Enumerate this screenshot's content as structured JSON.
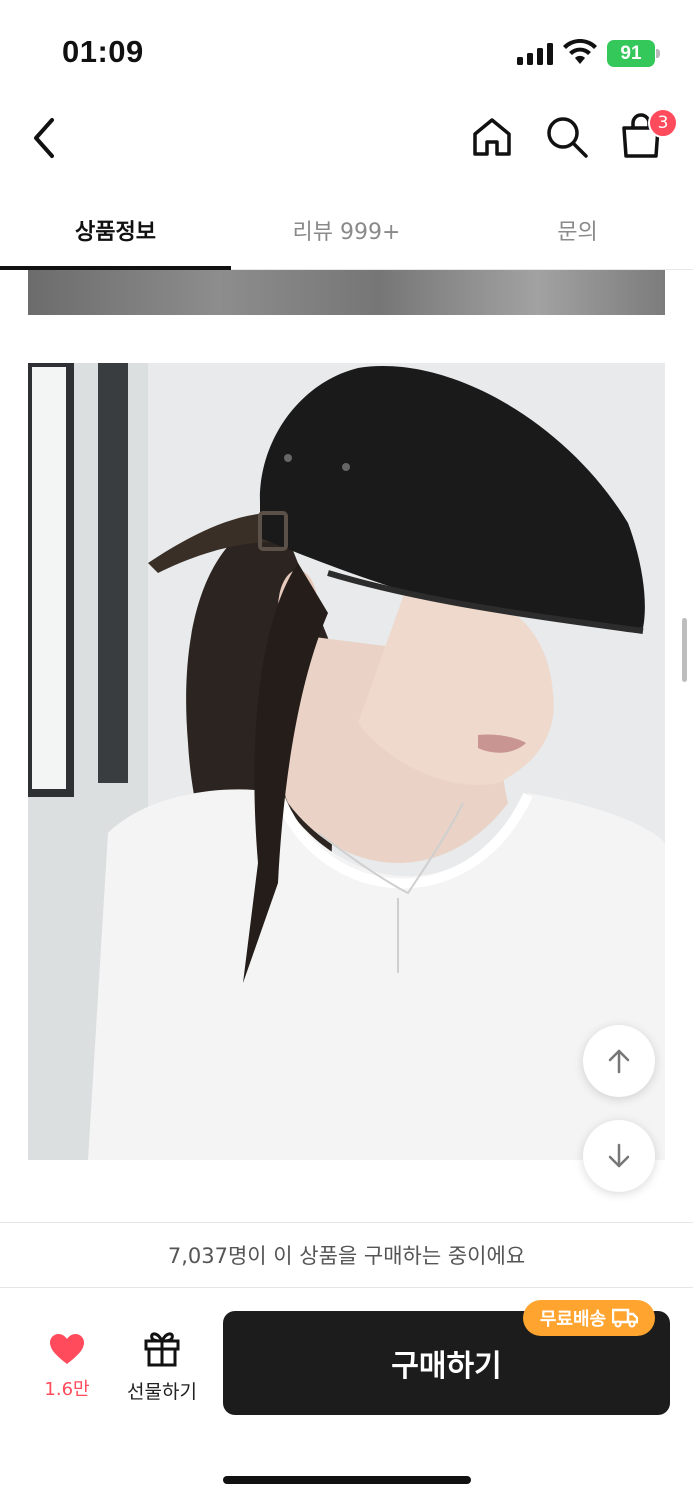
{
  "status": {
    "time": "01:09",
    "battery": "91"
  },
  "header": {
    "cart_count": "3"
  },
  "tabs": [
    {
      "label": "상품정보",
      "active": true
    },
    {
      "label": "리뷰 999+",
      "active": false
    },
    {
      "label": "문의",
      "active": false
    }
  ],
  "content": {
    "photo_alt": "black beret cap model photo"
  },
  "purchase_info": "7,037명이 이 상품을 구매하는 중이에요",
  "bottom": {
    "like_count": "1.6만",
    "gift_label": "선물하기",
    "buy_label": "구매하기",
    "free_shipping": "무료배송"
  },
  "colors": {
    "accent_red": "#ff4b5c",
    "buy_button": "#1c1c1c",
    "free_shipping_badge": "#ffa42e",
    "battery": "#34c759"
  },
  "icons": [
    "back-icon",
    "home-icon",
    "search-icon",
    "cart-icon",
    "arrow-up-icon",
    "arrow-down-icon",
    "heart-icon",
    "gift-icon",
    "truck-icon"
  ]
}
